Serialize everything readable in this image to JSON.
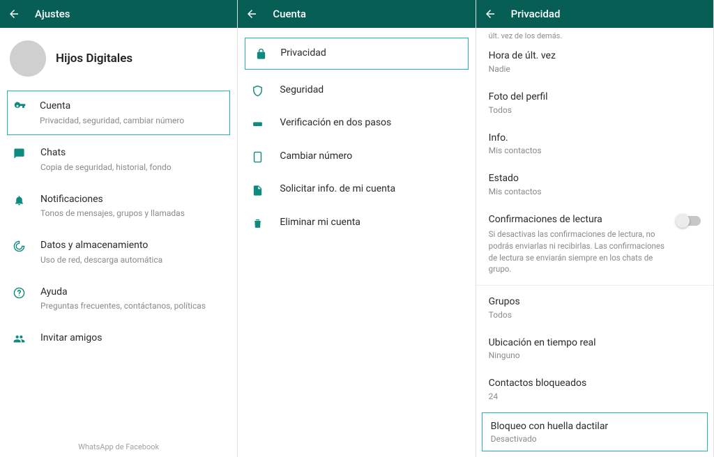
{
  "colors": {
    "header": "#075e54",
    "accent": "#1eb6a6",
    "icon": "#0f8a7e"
  },
  "ajustes": {
    "header": "Ajustes",
    "profile_name": "Hijos Digitales",
    "items": [
      {
        "title": "Cuenta",
        "sub": "Privacidad, seguridad, cambiar número"
      },
      {
        "title": "Chats",
        "sub": "Copia de seguridad, historial, fondo"
      },
      {
        "title": "Notificaciones",
        "sub": "Tonos de mensajes, grupos y llamadas"
      },
      {
        "title": "Datos y almacenamiento",
        "sub": "Uso de red, descarga automática"
      },
      {
        "title": "Ayuda",
        "sub": "Preguntas frecuentes, contáctanos, políticas"
      },
      {
        "title": "Invitar amigos"
      }
    ],
    "footer": "WhatsApp de Facebook"
  },
  "cuenta": {
    "header": "Cuenta",
    "items": [
      {
        "title": "Privacidad"
      },
      {
        "title": "Seguridad"
      },
      {
        "title": "Verificación en dos pasos"
      },
      {
        "title": "Cambiar número"
      },
      {
        "title": "Solicitar info. de mi cuenta"
      },
      {
        "title": "Eliminar mi cuenta"
      }
    ]
  },
  "privacidad": {
    "header": "Privacidad",
    "top_note": "últ. vez de los demás.",
    "items1": [
      {
        "title": "Hora de últ. vez",
        "sub": "Nadie"
      },
      {
        "title": "Foto del perfil",
        "sub": "Todos"
      },
      {
        "title": "Info.",
        "sub": "Mis contactos"
      },
      {
        "title": "Estado",
        "sub": "Mis contactos"
      }
    ],
    "read": {
      "title": "Confirmaciones de lectura",
      "desc": "Si desactivas las confirmaciones de lectura, no podrás enviarlas ni recibirlas. Las confirmaciones de lectura se enviarán siempre en los chats de grupo."
    },
    "items2": [
      {
        "title": "Grupos",
        "sub": "Todos"
      },
      {
        "title": "Ubicación en tiempo real",
        "sub": "Ninguno"
      },
      {
        "title": "Contactos bloqueados",
        "sub": "24"
      },
      {
        "title": "Bloqueo con huella dactilar",
        "sub": "Desactivado"
      }
    ]
  }
}
